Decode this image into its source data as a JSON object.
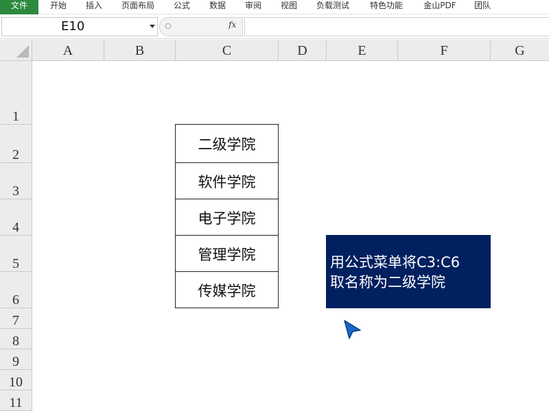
{
  "ribbon": {
    "tabs": [
      {
        "label": "文件"
      },
      {
        "label": "开始"
      },
      {
        "label": "插入"
      },
      {
        "label": "页面布局"
      },
      {
        "label": "公式"
      },
      {
        "label": "数据"
      },
      {
        "label": "审阅"
      },
      {
        "label": "视图"
      },
      {
        "label": "负载测试"
      },
      {
        "label": "特色功能"
      },
      {
        "label": "金山PDF"
      },
      {
        "label": "团队"
      }
    ]
  },
  "formula_bar": {
    "name_box": "E10",
    "fx_label": "fx",
    "formula": ""
  },
  "grid": {
    "columns": [
      "A",
      "B",
      "C",
      "D",
      "E",
      "F",
      "G"
    ],
    "rows": [
      "1",
      "2",
      "3",
      "4",
      "5",
      "6",
      "7",
      "8",
      "9",
      "10",
      "11"
    ],
    "cells_C": [
      "二级学院",
      "软件学院",
      "电子学院",
      "管理学院",
      "传媒学院"
    ]
  },
  "note": {
    "line1": "用公式菜单将C3:C6",
    "line2": "取名称为二级学院",
    "background": "#002060"
  },
  "cursor": {
    "icon": "arrow-cursor-icon",
    "color": "#1b66c9"
  }
}
